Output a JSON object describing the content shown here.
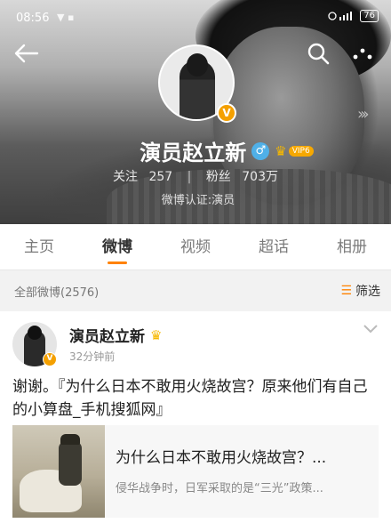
{
  "status_bar": {
    "time": "08:56",
    "signal": "▼ ▪",
    "battery": "76"
  },
  "profile": {
    "name": "演员赵立新",
    "verify_badge": "V",
    "gender_symbol": "♂",
    "vip_label": "VIP6",
    "following_label": "关注",
    "following_count": "257",
    "fans_label": "粉丝",
    "fans_count": "703万",
    "separator": "|",
    "certification": "微博认证:演员"
  },
  "tabs": [
    {
      "label": "主页"
    },
    {
      "label": "微博"
    },
    {
      "label": "视频"
    },
    {
      "label": "超话"
    },
    {
      "label": "相册"
    }
  ],
  "feed": {
    "all_posts_label": "全部微博(2576)",
    "filter_label": "筛选",
    "filter_icon": "☰"
  },
  "post": {
    "author": "演员赵立新",
    "time": "32分钟前",
    "text": "谢谢。『为什么日本不敢用火烧故宫？原来他们有自己的小算盘_手机搜狐网』",
    "link_card": {
      "title": "为什么日本不敢用火烧故宫？...",
      "description": "侵华战争时，日军采取的是“三光”政策..."
    }
  },
  "colors": {
    "accent": "#ff8200",
    "verify": "#f4a000",
    "vip": "#f6a800",
    "gender": "#4fb0e8"
  },
  "icons": [
    "back-arrow-icon",
    "search-icon",
    "more-icon",
    "verified-icon",
    "gender-male-icon",
    "vip-crown-icon",
    "chevron-down-icon",
    "filter-icon"
  ]
}
